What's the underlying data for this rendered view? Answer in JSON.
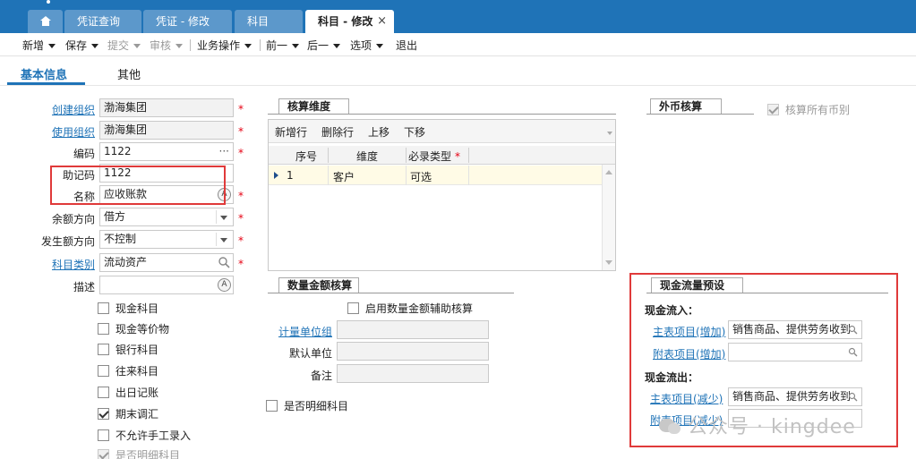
{
  "tabs": [
    {
      "label": ""
    },
    {
      "label": "凭证查询"
    },
    {
      "label": "凭证 - 修改"
    },
    {
      "label": "科目"
    },
    {
      "label": "科目 - 修改"
    }
  ],
  "tab_close": "×",
  "toolbar": {
    "new": "新增",
    "save": "保存",
    "submit": "提交",
    "audit": "审核",
    "business": "业务操作",
    "prev": "前一",
    "next": "后一",
    "options": "选项",
    "exit": "退出"
  },
  "subtabs": {
    "basic": "基本信息",
    "other": "其他"
  },
  "form": {
    "create_org_label": "创建组织",
    "create_org_value": "渤海集团",
    "use_org_label": "使用组织",
    "use_org_value": "渤海集团",
    "code_label": "编码",
    "code_value": "1122",
    "code_more": "···",
    "mnemonic_label": "助记码",
    "mnemonic_value": "1122",
    "name_label": "名称",
    "name_value": "应收账款",
    "balance_dir_label": "余额方向",
    "balance_dir_value": "借方",
    "occur_dir_label": "发生额方向",
    "occur_dir_value": "不控制",
    "category_label": "科目类别",
    "category_value": "流动资产",
    "desc_label": "描述",
    "desc_value": "",
    "required_mark": "*",
    "multilang_glyph": "A"
  },
  "checkboxes": [
    {
      "label": "现金科目",
      "checked": false,
      "disabled": false
    },
    {
      "label": "现金等价物",
      "checked": false,
      "disabled": false
    },
    {
      "label": "银行科目",
      "checked": false,
      "disabled": false
    },
    {
      "label": "往来科目",
      "checked": false,
      "disabled": false
    },
    {
      "label": "出日记账",
      "checked": false,
      "disabled": false
    },
    {
      "label": "期末调汇",
      "checked": true,
      "disabled": false
    },
    {
      "label": "不允许手工录入",
      "checked": false,
      "disabled": false
    },
    {
      "label": "是否明细科目",
      "checked": true,
      "disabled": true
    }
  ],
  "accounting": {
    "title": "核算维度",
    "add_row": "新增行",
    "delete_row": "删除行",
    "move_up": "上移",
    "move_down": "下移",
    "columns": [
      "序号",
      "维度",
      "必录类型"
    ],
    "rows": [
      {
        "seq": "1",
        "dimension": "客户",
        "required_type": "可选"
      }
    ]
  },
  "quantity": {
    "title": "数量金额核算",
    "enable_label": "启用数量金额辅助核算",
    "unit_group_label": "计量单位组",
    "default_unit_label": "默认单位",
    "remark_label": "备注",
    "is_detail_label": "是否明细科目"
  },
  "foreign": {
    "title": "外币核算",
    "all_currency_label": "核算所有币别"
  },
  "cashflow": {
    "title": "现金流量预设",
    "inflow_label": "现金流入：",
    "outflow_label": "现金流出：",
    "in_main_label": "主表项目(增加)",
    "in_main_value": "销售商品、提供劳务收到",
    "in_sub_label": "附表项目(增加)",
    "in_sub_value": "",
    "out_main_label": "主表项目(减少)",
    "out_main_value": "销售商品、提供劳务收到",
    "out_sub_label": "附表项目(减少)",
    "out_sub_value": ""
  },
  "watermark": "公众号 · kingdee",
  "colors": {
    "brand": "#1f73b7",
    "highlight": "#e03a3a",
    "required": "#e60012"
  }
}
